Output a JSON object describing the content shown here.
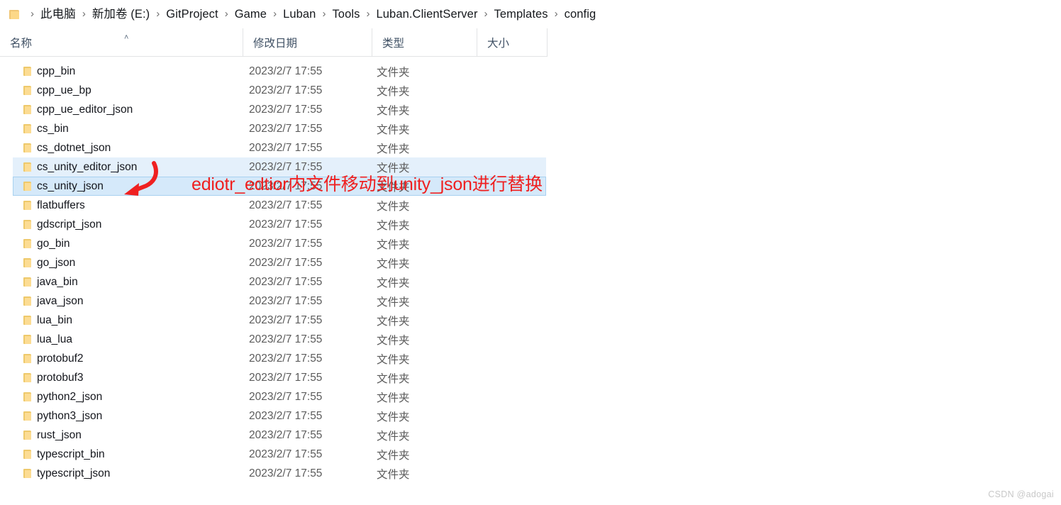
{
  "breadcrumb": {
    "leading_icon": "folder-icon",
    "separator": "›",
    "items": [
      "此电脑",
      "新加卷 (E:)",
      "GitProject",
      "Game",
      "Luban",
      "Tools",
      "Luban.ClientServer",
      "Templates",
      "config"
    ]
  },
  "columns": {
    "name": "名称",
    "date_modified": "修改日期",
    "type": "类型",
    "size": "大小",
    "sort_caret": "˄"
  },
  "rows": [
    {
      "name": "cpp_bin",
      "date": "2023/2/7 17:55",
      "type": "文件夹",
      "size": "",
      "selected": false,
      "focused": false
    },
    {
      "name": "cpp_ue_bp",
      "date": "2023/2/7 17:55",
      "type": "文件夹",
      "size": "",
      "selected": false,
      "focused": false
    },
    {
      "name": "cpp_ue_editor_json",
      "date": "2023/2/7 17:55",
      "type": "文件夹",
      "size": "",
      "selected": false,
      "focused": false
    },
    {
      "name": "cs_bin",
      "date": "2023/2/7 17:55",
      "type": "文件夹",
      "size": "",
      "selected": false,
      "focused": false
    },
    {
      "name": "cs_dotnet_json",
      "date": "2023/2/7 17:55",
      "type": "文件夹",
      "size": "",
      "selected": false,
      "focused": false
    },
    {
      "name": "cs_unity_editor_json",
      "date": "2023/2/7 17:55",
      "type": "文件夹",
      "size": "",
      "selected": true,
      "focused": false
    },
    {
      "name": "cs_unity_json",
      "date": "2023/2/7 17:55",
      "type": "文件夹",
      "size": "",
      "selected": true,
      "focused": true
    },
    {
      "name": "flatbuffers",
      "date": "2023/2/7 17:55",
      "type": "文件夹",
      "size": "",
      "selected": false,
      "focused": false
    },
    {
      "name": "gdscript_json",
      "date": "2023/2/7 17:55",
      "type": "文件夹",
      "size": "",
      "selected": false,
      "focused": false
    },
    {
      "name": "go_bin",
      "date": "2023/2/7 17:55",
      "type": "文件夹",
      "size": "",
      "selected": false,
      "focused": false
    },
    {
      "name": "go_json",
      "date": "2023/2/7 17:55",
      "type": "文件夹",
      "size": "",
      "selected": false,
      "focused": false
    },
    {
      "name": "java_bin",
      "date": "2023/2/7 17:55",
      "type": "文件夹",
      "size": "",
      "selected": false,
      "focused": false
    },
    {
      "name": "java_json",
      "date": "2023/2/7 17:55",
      "type": "文件夹",
      "size": "",
      "selected": false,
      "focused": false
    },
    {
      "name": "lua_bin",
      "date": "2023/2/7 17:55",
      "type": "文件夹",
      "size": "",
      "selected": false,
      "focused": false
    },
    {
      "name": "lua_lua",
      "date": "2023/2/7 17:55",
      "type": "文件夹",
      "size": "",
      "selected": false,
      "focused": false
    },
    {
      "name": "protobuf2",
      "date": "2023/2/7 17:55",
      "type": "文件夹",
      "size": "",
      "selected": false,
      "focused": false
    },
    {
      "name": "protobuf3",
      "date": "2023/2/7 17:55",
      "type": "文件夹",
      "size": "",
      "selected": false,
      "focused": false
    },
    {
      "name": "python2_json",
      "date": "2023/2/7 17:55",
      "type": "文件夹",
      "size": "",
      "selected": false,
      "focused": false
    },
    {
      "name": "python3_json",
      "date": "2023/2/7 17:55",
      "type": "文件夹",
      "size": "",
      "selected": false,
      "focused": false
    },
    {
      "name": "rust_json",
      "date": "2023/2/7 17:55",
      "type": "文件夹",
      "size": "",
      "selected": false,
      "focused": false
    },
    {
      "name": "typescript_bin",
      "date": "2023/2/7 17:55",
      "type": "文件夹",
      "size": "",
      "selected": false,
      "focused": false
    },
    {
      "name": "typescript_json",
      "date": "2023/2/7 17:55",
      "type": "文件夹",
      "size": "",
      "selected": false,
      "focused": false
    }
  ],
  "annotation": {
    "text": "ediotr_edtior内文件移动到unity_json进行替换",
    "color": "#ef2020",
    "arrow": "curved-arrow-pointing-down-left"
  },
  "watermark": "CSDN @adogai",
  "colors": {
    "selection_fill": "#e4f0fb",
    "selection_focus_fill": "#d5e9fa",
    "selection_border": "#a8d1f0",
    "folder_icon": "#fcd888",
    "annotation_red": "#ef2020",
    "header_text": "#3f5064",
    "row_text": "#14161c",
    "meta_text": "#5b5b5b"
  }
}
